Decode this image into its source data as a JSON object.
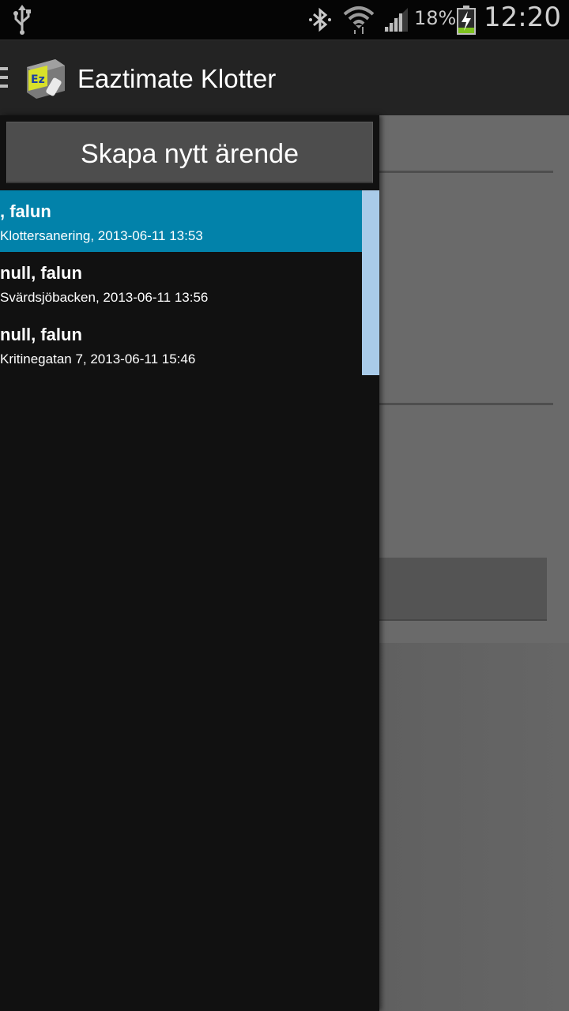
{
  "status_bar": {
    "battery_percent": "18%",
    "time": "12:20",
    "icons": [
      "usb-icon",
      "bluetooth-icon",
      "wifi-icon",
      "signal-icon",
      "battery-charging-icon"
    ]
  },
  "action_bar": {
    "title": "Eaztimate Klotter",
    "logo": "app-logo-icon"
  },
  "drawer": {
    "new_button_label": "Skapa nytt ärende",
    "items": [
      {
        "title": ", falun",
        "subtitle": "Klottersanering, 2013-06-11  13:53",
        "selected": true
      },
      {
        "title": "null, falun",
        "subtitle": "Svärdsjöbacken, 2013-06-11  13:56",
        "selected": false
      },
      {
        "title": "null, falun",
        "subtitle": "Kritinegatan 7, 2013-06-11  15:46",
        "selected": false
      }
    ]
  },
  "colors": {
    "selected_item": "#0282aa",
    "scrollbar": "#a9cbe9",
    "drawer_bg": "#111111",
    "action_bar_bg": "#232323"
  }
}
